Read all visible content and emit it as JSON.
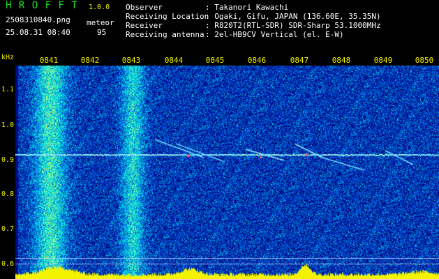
{
  "app": {
    "name": "H R O F F T",
    "version": "1.0.0",
    "filename": "2508310840.png",
    "meteor_label": "meteor",
    "datetime": "25.08.31 08:40",
    "meteor_count": "95"
  },
  "info": {
    "rows": [
      {
        "label": "Observer",
        "value": ": Takanori Kawachi"
      },
      {
        "label": "Receiving Location",
        "value": ": Ogaki, Gifu, JAPAN (136.60E, 35.35N)"
      },
      {
        "label": "Receiver",
        "value": ": R820T2(RTL-SDR) SDR-Sharp 53.1000MHz"
      },
      {
        "label": "Receiving antenna",
        "value": ": 2el-HB9CV Vertical (el. E-W)"
      }
    ]
  },
  "axis": {
    "unit": "kHz",
    "x_ticks": [
      "0841",
      "0842",
      "0843",
      "0844",
      "0845",
      "0846",
      "0847",
      "0848",
      "0849",
      "0850"
    ],
    "y_ticks": [
      "1.1",
      "1.0",
      "0.9",
      "0.8",
      "0.7",
      "0.6"
    ]
  },
  "colors": {
    "background": "#000000",
    "spectrum_base": "#0a1a8c",
    "signal_line": "#7fe0ff",
    "level_bar": "#f3f300",
    "title_green": "#1ee01e",
    "label_yellow": "#f3f300"
  }
}
